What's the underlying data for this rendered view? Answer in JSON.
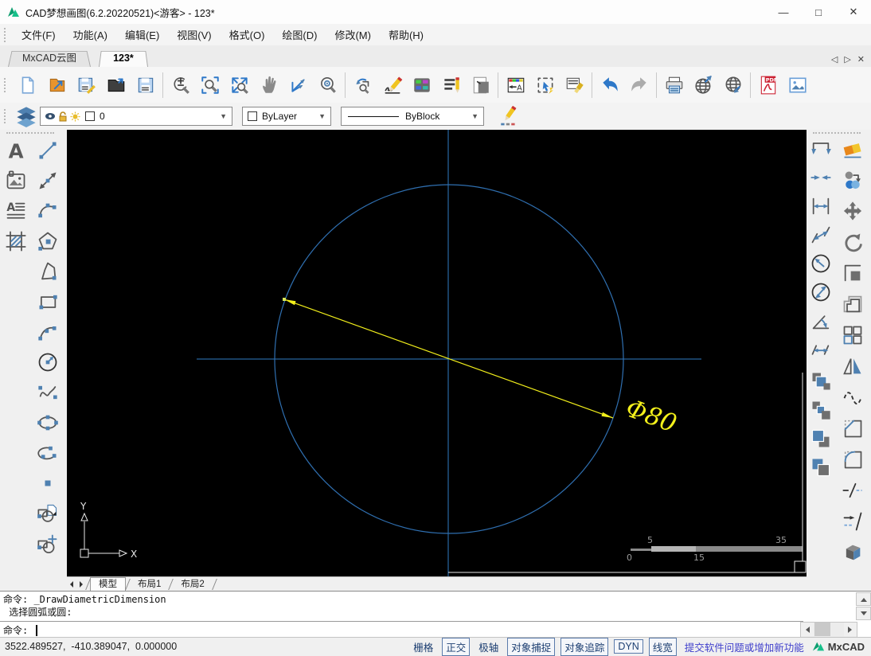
{
  "window": {
    "title": "CAD梦想画图(6.2.20220521)<游客> - 123*",
    "minimize_glyph": "—",
    "maximize_glyph": "□",
    "close_glyph": "✕"
  },
  "menu": {
    "items": [
      {
        "label": "文件(F)"
      },
      {
        "label": "功能(A)"
      },
      {
        "label": "编辑(E)"
      },
      {
        "label": "视图(V)"
      },
      {
        "label": "格式(O)"
      },
      {
        "label": "绘图(D)"
      },
      {
        "label": "修改(M)"
      },
      {
        "label": "帮助(H)"
      }
    ]
  },
  "doc_tabs": {
    "tabs": [
      {
        "label": "MxCAD云图"
      },
      {
        "label": "123*"
      }
    ],
    "prev_glyph": "◁",
    "next_glyph": "▷",
    "close_glyph": "✕"
  },
  "toolbar": {
    "icons": [
      "new-file",
      "open-drawing",
      "save",
      "open-folder",
      "save-as",
      "zoom-in-out",
      "zoom-window",
      "zoom-extents",
      "pan",
      "measure",
      "zoom-center",
      "view-previous",
      "sketch",
      "color-palette",
      "text-style",
      "page-setup",
      "dimension-style",
      "quick-select",
      "match-properties",
      "undo",
      "redo",
      "print",
      "publish-web",
      "open-web",
      "export-pdf",
      "export-image"
    ]
  },
  "properties_bar": {
    "layer_value": "0",
    "color_value": "ByLayer",
    "linetype_value": "ByBlock"
  },
  "left_toolbar": {
    "icons": [
      "text",
      "image",
      "mtext",
      "hatch",
      "line",
      "construction-line",
      "arc-3point",
      "polygon",
      "polyline",
      "rectangle",
      "arc",
      "circle",
      "spline",
      "ellipse",
      "ellipse-arc",
      "point",
      "make-block",
      "insert-block"
    ]
  },
  "right_toolbar": {
    "dim_icons": [
      "quick-dimension",
      "dimension-break",
      "linear-dimension",
      "aligned-dimension",
      "radius-dimension",
      "diametric-dimension",
      "angular-dimension",
      "rotated-dimension",
      "draworder-front",
      "draworder-back",
      "draworder-above",
      "draworder-below"
    ],
    "modify_icons": [
      "erase",
      "copy",
      "move",
      "rotate",
      "scale",
      "offset",
      "array",
      "mirror",
      "edit-curve",
      "chamfer",
      "fillet",
      "break",
      "lengthen",
      "3d-box"
    ]
  },
  "canvas": {
    "dimension_text": "Φ80",
    "ucs": {
      "x_label": "X",
      "y_label": "Y"
    },
    "scale_bar": {
      "top_left": "5",
      "top_right": "35",
      "bottom_left": "0",
      "bottom_right": "15"
    },
    "colors": {
      "background": "#000000",
      "circle": "#2f6fb0",
      "crosshair": "#2f7bc4",
      "dimension": "#f3f01b"
    }
  },
  "layout_tabs": {
    "tabs": [
      {
        "label": "模型"
      },
      {
        "label": "布局1"
      },
      {
        "label": "布局2"
      }
    ]
  },
  "command_window": {
    "history_line1": "命令: _DrawDiametricDimension",
    "history_line2": " 选择圆弧或圆:",
    "prompt": "命令: "
  },
  "status_bar": {
    "coordinates": "3522.489527,  -410.389047,  0.000000",
    "toggles": [
      {
        "label": "栅格",
        "active": false
      },
      {
        "label": "正交",
        "active": true
      },
      {
        "label": "极轴",
        "active": false
      },
      {
        "label": "对象捕捉",
        "active": true
      },
      {
        "label": "对象追踪",
        "active": true
      },
      {
        "label": "DYN",
        "active": true
      },
      {
        "label": "线宽",
        "active": true
      }
    ],
    "feedback_link": "提交软件问题或增加新功能",
    "brand": "MxCAD"
  }
}
